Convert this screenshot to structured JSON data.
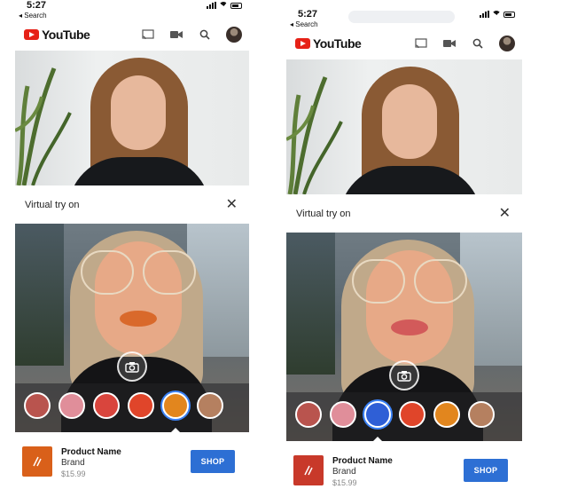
{
  "status_bar": {
    "time": "5:27",
    "back_label": "◂ Search"
  },
  "youtube": {
    "logo_text": "YouTube",
    "icons": [
      "cast-icon",
      "camera-icon",
      "search-icon",
      "account-avatar"
    ],
    "brand_color": "#e62117"
  },
  "try_on": {
    "title": "Virtual try on",
    "close_icon": "close-icon"
  },
  "phones": [
    {
      "lip_color": "#d9692b",
      "swatches": [
        "#b9544e",
        "#e08e9a",
        "#d9453d",
        "#e0452a",
        "#e2861e",
        "#b58060"
      ],
      "selected_index": 4,
      "thumb_color": "#d9601a"
    },
    {
      "lip_color": "#d25a5a",
      "swatches": [
        "#b9544e",
        "#e08e9a",
        "#2f5fd6",
        "#e0452a",
        "#e2861e",
        "#b58060"
      ],
      "selected_index": 2,
      "thumb_color": "#c8392a"
    }
  ],
  "product": {
    "name": "Product Name",
    "brand": "Brand",
    "price": "$15.99",
    "shop_label": "SHOP",
    "shop_color": "#2d6fd4"
  }
}
